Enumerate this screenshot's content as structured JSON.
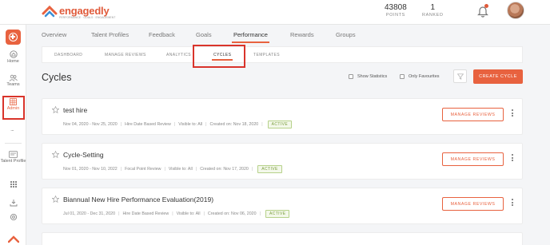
{
  "brand": {
    "name": "engagedly",
    "tagline": "PERFORMANCE · GOALS · ENGAGEMENT",
    "accent": "#e8623f"
  },
  "header": {
    "points": {
      "value": "43808",
      "label": "POINTS"
    },
    "ranked": {
      "value": "1",
      "label": "RANKED"
    }
  },
  "sidebar": {
    "home": "Home",
    "teams": "Teams",
    "admin": "Admin",
    "more": "...",
    "talent_profile": "Talent Profile"
  },
  "nav": {
    "tabs": [
      "Overview",
      "Talent Profiles",
      "Feedback",
      "Goals",
      "Performance",
      "Rewards",
      "Groups"
    ],
    "active": "Performance"
  },
  "subnav": {
    "tabs": [
      "DASHBOARD",
      "MANAGE REVIEWS",
      "ANALYTICS",
      "CYCLES",
      "TEMPLATES"
    ],
    "active": "CYCLES"
  },
  "page": {
    "title": "Cycles",
    "show_statistics": "Show Statistics",
    "only_favourites": "Only Favourites",
    "create_label": "CREATE CYCLE"
  },
  "cycles": [
    {
      "name": "test hire",
      "dates": "Nov 04, 2020 - Nov 25, 2020",
      "type": "Hire Date Based Review",
      "visible": "Visible to: All",
      "created": "Created on: Nov 18, 2020",
      "status": "ACTIVE",
      "action": "MANAGE REVIEWS"
    },
    {
      "name": "Cycle-Setting",
      "dates": "Nov 01, 2020 - Nov 10, 2022",
      "type": "Focal Point Review",
      "visible": "Visible to: All",
      "created": "Created on: Nov 17, 2020",
      "status": "ACTIVE",
      "action": "MANAGE REVIEWS"
    },
    {
      "name": "Biannual New Hire Performance Evaluation(2019)",
      "dates": "Jul 01, 2020 - Dec 31, 2020",
      "type": "Hire Date Based Review",
      "visible": "Visible to: All",
      "created": "Created on: Nov 06, 2020",
      "status": "ACTIVE",
      "action": "MANAGE REVIEWS"
    }
  ]
}
